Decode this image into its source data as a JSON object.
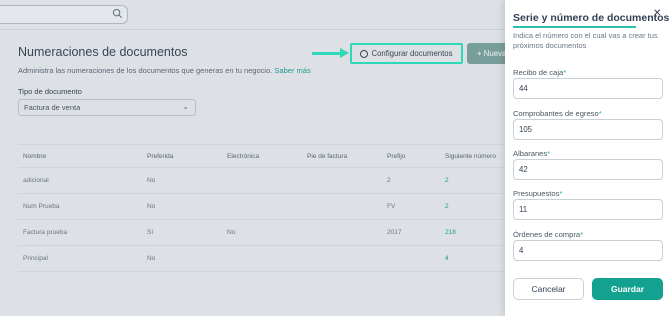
{
  "colors": {
    "accent": "#14a290",
    "highlight": "#2fd8b8",
    "overlay": "#dde1e6"
  },
  "background": {
    "title": "Numeraciones de documentos",
    "subtitle": "Administra las numeraciones de los documentos que generas en tu negocio.",
    "subtitle_link": "Saber más",
    "configure_button": "Configurar documentos",
    "configure_icon": "settings-icon",
    "new_button": "+ Nueva",
    "doc_type_label": "Tipo de documento",
    "doc_type_value": "Factura de venta",
    "table": {
      "headers": [
        "Nombre",
        "Preferida",
        "Electrónica",
        "Pie de factura",
        "Prefijo",
        "Siguiente número"
      ],
      "rows": [
        [
          "adicional",
          "No",
          "",
          "",
          "2",
          "2"
        ],
        [
          "Num Prueba",
          "No",
          "",
          "",
          "FV",
          "2"
        ],
        [
          "Factura prueba",
          "Sí",
          "No",
          "",
          "2017",
          "218"
        ],
        [
          "Principal",
          "No",
          "",
          "",
          "",
          "4"
        ]
      ]
    }
  },
  "panel": {
    "title": "Serie y número de documentos",
    "description": "Indica el número con el cual vas a crear tus próximos documentos",
    "close_icon": "close-icon",
    "fields": [
      {
        "label": "Recibo de caja",
        "value": "44"
      },
      {
        "label": "Comprobantes de egreso",
        "value": "105"
      },
      {
        "label": "Albaranes",
        "value": "42"
      },
      {
        "label": "Presupuestos",
        "value": "11"
      },
      {
        "label": "Órdenes de compra",
        "value": "4"
      }
    ],
    "required_mark": "*",
    "cancel_button": "Cancelar",
    "save_button": "Guardar"
  }
}
